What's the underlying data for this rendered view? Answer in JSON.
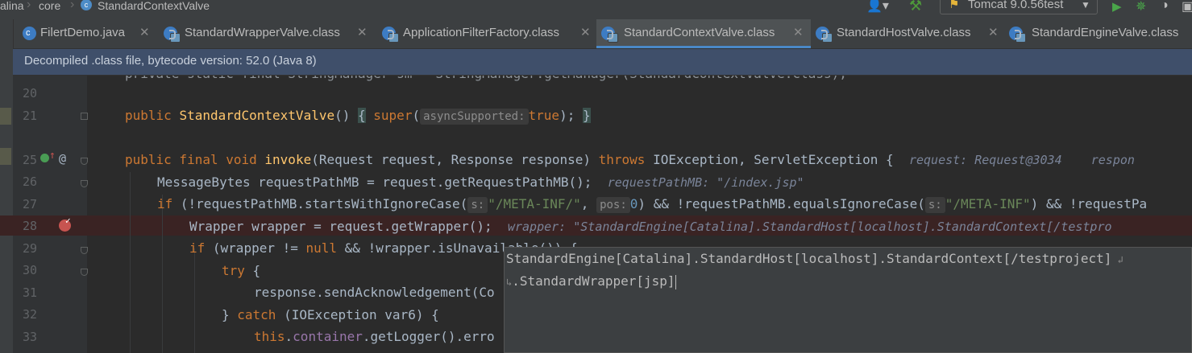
{
  "navbar": {
    "crumbs": [
      "alina",
      "core",
      "StandardContextValve"
    ],
    "run_config": "Tomcat 9.0.56test"
  },
  "tabs": [
    {
      "label": "FilertDemo.java",
      "active": false
    },
    {
      "label": "StandardWrapperValve.class",
      "active": false
    },
    {
      "label": "ApplicationFilterFactory.class",
      "active": false
    },
    {
      "label": "StandardContextValve.class",
      "active": true
    },
    {
      "label": "StandardHostValve.class",
      "active": false
    },
    {
      "label": "StandardEngineValve.class",
      "active": false
    }
  ],
  "banner": {
    "text": "Decompiled .class file, bytecode version: 52.0 (Java 8)"
  },
  "gutter": {
    "line_numbers": [
      "20",
      "21",
      "25",
      "26",
      "27",
      "28",
      "29",
      "30",
      "31",
      "32",
      "33"
    ]
  },
  "code": {
    "l19": "private static final StringManager sm = StringManager.getManager(StandardContextValve.class);",
    "l21": {
      "kw_public": "public",
      "name": "StandardContextValve",
      "parens": "()",
      "ob": "{",
      "kw_super": "super",
      "p1": "(",
      "hint": "asyncSupported:",
      "kw_true": "true",
      "p2": ");",
      "cb": "}"
    },
    "l25": {
      "kw": "public final void",
      "name": "invoke",
      "sig": "(Request request, Response response)",
      "kw_throws": "throws",
      "rest": "IOException, ServletException {",
      "dbg": "request: Request@3034    respon"
    },
    "l26": {
      "text": "MessageBytes requestPathMB = request.getRequestPathMB();",
      "dbg": "requestPathMB: \"/index.jsp\""
    },
    "l27": {
      "kw_if": "if",
      "t1": "(!requestPathMB.startsWithIgnoreCase(",
      "h1": "s:",
      "s1": "\"/META-INF/\"",
      "t2": ",",
      "h2": "pos:",
      "n1": "0",
      "t3": ") && !requestPathMB.equalsIgnoreCase(",
      "h3": "s:",
      "s2": "\"/META-INF\"",
      "t4": ") && !requestPa"
    },
    "l28": {
      "text": "Wrapper wrapper = request.getWrapper();",
      "dbg": "wrapper: \"StandardEngine[Catalina].StandardHost[localhost].StandardContext[/testpro"
    },
    "l29": {
      "kw_if": "if",
      "t1": "(wrapper != ",
      "kw_null": "null",
      "t2": " && !wrapper.isUnavailable()) {"
    },
    "l30": {
      "kw_try": "try",
      "t1": " {"
    },
    "l31": {
      "text": "response.sendAcknowledgement(Co"
    },
    "l32": {
      "t1": "} ",
      "kw_catch": "catch",
      "t2": " (IOException var6) {"
    },
    "l33": {
      "kw_this": "this",
      "t1": ".",
      "fld": "container",
      "t2": ".getLogger().erro"
    }
  },
  "popup": {
    "line1": "StandardEngine[Catalina].StandardHost[localhost].StandardContext[/testproject]",
    "line2": ".StandardWrapper[jsp]"
  },
  "colors": {
    "keyword": "#cc7832",
    "method": "#ffc66d",
    "string": "#6a8759",
    "number": "#6897bb",
    "field": "#9876aa",
    "accent": "#4a88c7"
  }
}
